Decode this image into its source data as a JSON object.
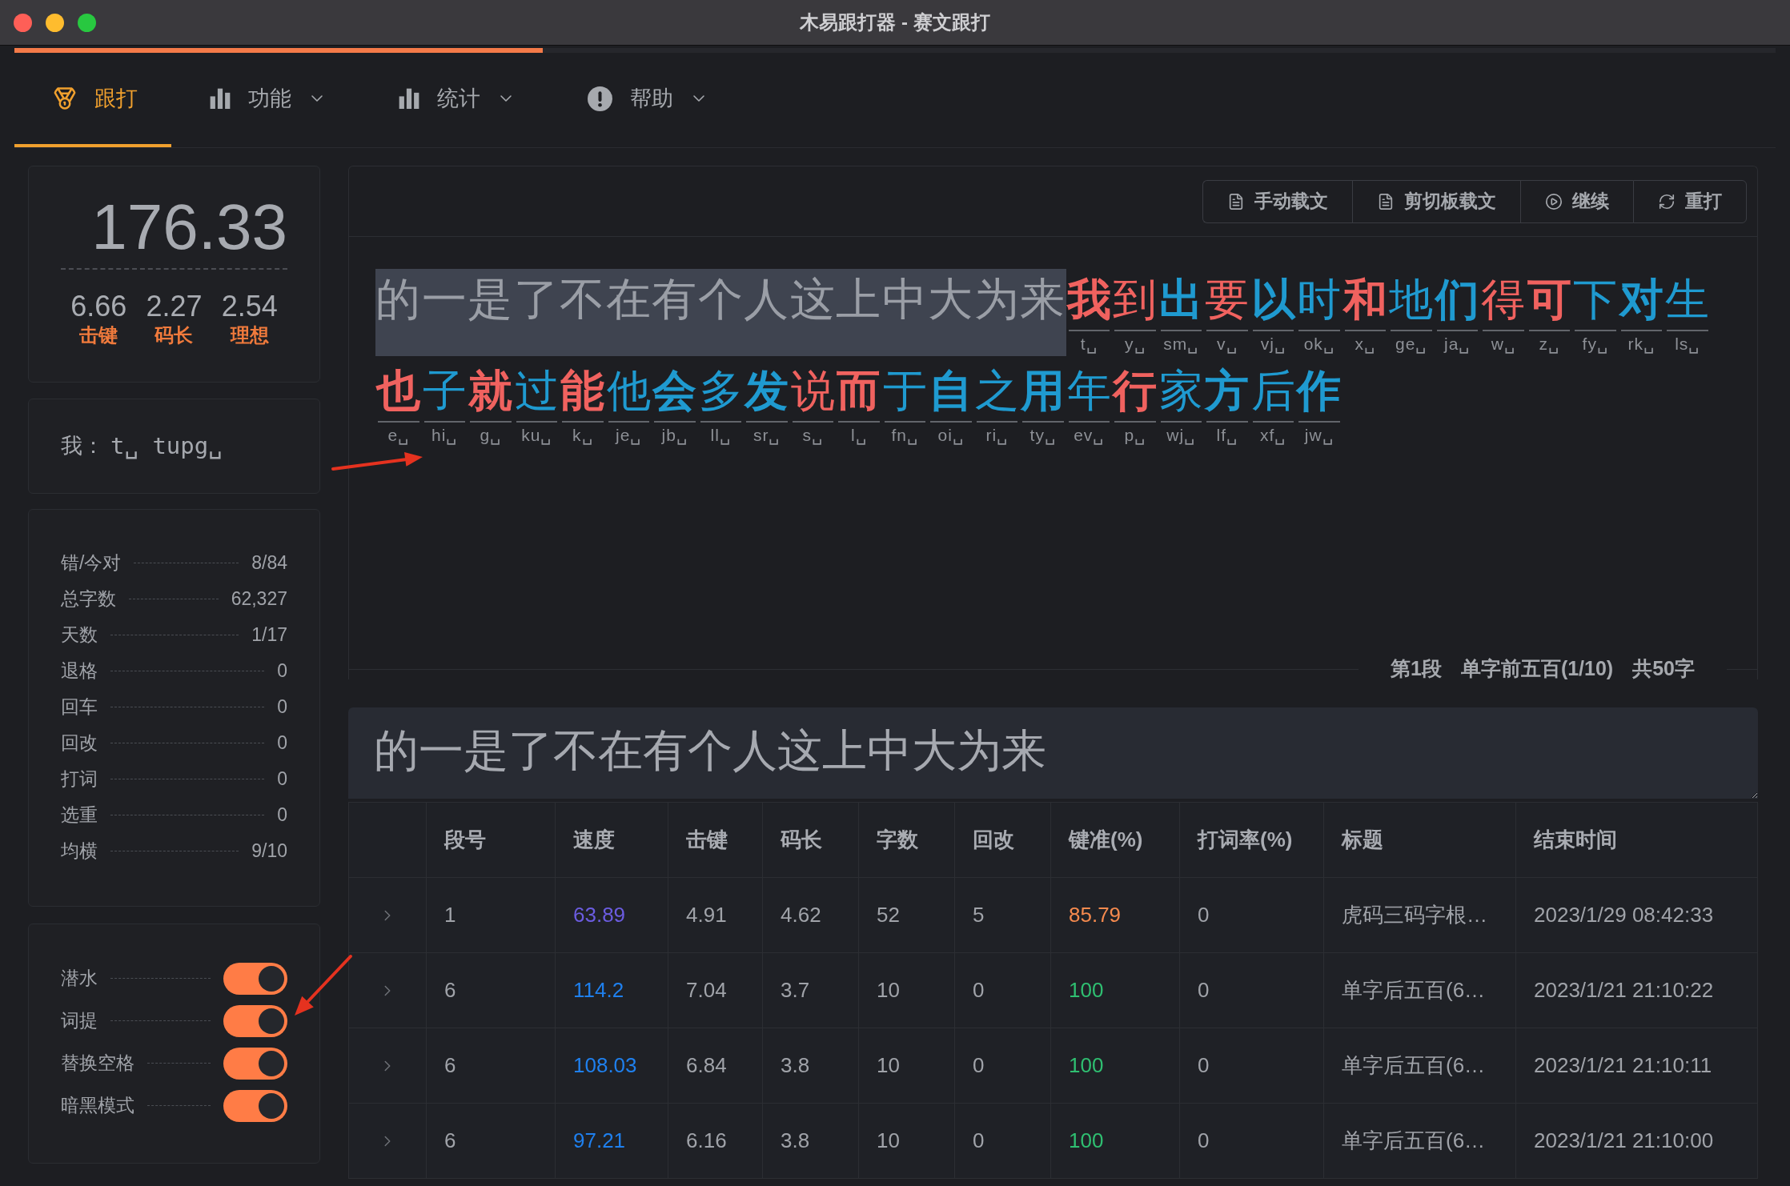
{
  "window": {
    "title": "木易跟打器 - 赛文跟打"
  },
  "progress": {
    "level": 0.3
  },
  "tabs": [
    {
      "label": "跟打",
      "selected": true,
      "has_menu": false
    },
    {
      "label": "功能",
      "selected": false,
      "has_menu": true
    },
    {
      "label": "统计",
      "selected": false,
      "has_menu": true
    },
    {
      "label": "帮助",
      "selected": false,
      "has_menu": true
    }
  ],
  "speed_panel": {
    "speed": "176.33",
    "stats": [
      {
        "value": "6.66",
        "label": "击键"
      },
      {
        "value": "2.27",
        "label": "码长"
      },
      {
        "value": "2.54",
        "label": "理想"
      }
    ]
  },
  "typing_hint": {
    "label": "我：",
    "codes": "t␣ tupg␣"
  },
  "stats": [
    {
      "label": "错/今对",
      "value": "8/84"
    },
    {
      "label": "总字数",
      "value": "62,327"
    },
    {
      "label": "天数",
      "value": "1/17"
    },
    {
      "label": "退格",
      "value": "0"
    },
    {
      "label": "回车",
      "value": "0"
    },
    {
      "label": "回改",
      "value": "0"
    },
    {
      "label": "打词",
      "value": "0"
    },
    {
      "label": "选重",
      "value": "0"
    },
    {
      "label": "均横",
      "value": "9/10"
    }
  ],
  "switches": [
    {
      "label": "潜水",
      "on": true
    },
    {
      "label": "词提",
      "on": true
    },
    {
      "label": "替换空格",
      "on": true
    },
    {
      "label": "暗黑模式",
      "on": true
    }
  ],
  "toolbar": {
    "buttons": [
      "手动载文",
      "剪切板载文",
      "继续",
      "重打"
    ]
  },
  "passage": {
    "lines": [
      {
        "typed": "的一是了不在有个人这上中大为来",
        "chars": [
          {
            "char": "我",
            "code": "t␣",
            "color": "#f0625f"
          },
          {
            "char": "到",
            "code": "y␣",
            "color": "#f0625f"
          },
          {
            "char": "出",
            "code": "sm␣",
            "color": "#1f9ad0"
          },
          {
            "char": "要",
            "code": "v␣",
            "color": "#f0625f"
          },
          {
            "char": "以",
            "code": "vj␣",
            "color": "#1f9ad0"
          },
          {
            "char": "时",
            "code": "ok␣",
            "color": "#1f9ad0"
          },
          {
            "char": "和",
            "code": "x␣",
            "color": "#f0625f"
          },
          {
            "char": "地",
            "code": "ge␣",
            "color": "#1f9ad0"
          },
          {
            "char": "们",
            "code": "ja␣",
            "color": "#1f9ad0"
          },
          {
            "char": "得",
            "code": "w␣",
            "color": "#f0625f"
          },
          {
            "char": "可",
            "code": "z␣",
            "color": "#f0625f"
          },
          {
            "char": "下",
            "code": "fy␣",
            "color": "#1f9ad0"
          },
          {
            "char": "对",
            "code": "rk␣",
            "color": "#1f9ad0"
          },
          {
            "char": "生",
            "code": "ls␣",
            "color": "#1f9ad0"
          }
        ]
      },
      {
        "chars": [
          {
            "char": "也",
            "code": "e␣",
            "color": "#f0625f"
          },
          {
            "char": "子",
            "code": "hi␣",
            "color": "#1f9ad0"
          },
          {
            "char": "就",
            "code": "g␣",
            "color": "#f0625f"
          },
          {
            "char": "过",
            "code": "ku␣",
            "color": "#1f9ad0"
          },
          {
            "char": "能",
            "code": "k␣",
            "color": "#f0625f"
          },
          {
            "char": "他",
            "code": "je␣",
            "color": "#1f9ad0"
          },
          {
            "char": "会",
            "code": "jb␣",
            "color": "#1f9ad0"
          },
          {
            "char": "多",
            "code": "ll␣",
            "color": "#1f9ad0"
          },
          {
            "char": "发",
            "code": "sr␣",
            "color": "#1f9ad0"
          },
          {
            "char": "说",
            "code": "s␣",
            "color": "#f0625f"
          },
          {
            "char": "而",
            "code": "l␣",
            "color": "#f0625f"
          },
          {
            "char": "于",
            "code": "fn␣",
            "color": "#1f9ad0"
          },
          {
            "char": "自",
            "code": "oi␣",
            "color": "#1f9ad0"
          },
          {
            "char": "之",
            "code": "ri␣",
            "color": "#1f9ad0"
          },
          {
            "char": "用",
            "code": "ty␣",
            "color": "#1f9ad0"
          },
          {
            "char": "年",
            "code": "ev␣",
            "color": "#1f9ad0"
          },
          {
            "char": "行",
            "code": "p␣",
            "color": "#f0625f"
          },
          {
            "char": "家",
            "code": "wj␣",
            "color": "#1f9ad0"
          },
          {
            "char": "方",
            "code": "lf␣",
            "color": "#1f9ad0"
          },
          {
            "char": "后",
            "code": "xf␣",
            "color": "#1f9ad0"
          },
          {
            "char": "作",
            "code": "jw␣",
            "color": "#1f9ad0"
          }
        ]
      }
    ]
  },
  "status": [
    "第1段",
    "单字前五百(1/10)",
    "共50字"
  ],
  "input": {
    "value": "的一是了不在有个人这上中大为来"
  },
  "table": {
    "columns": [
      "段号",
      "速度",
      "击键",
      "码长",
      "字数",
      "回改",
      "键准(%)",
      "打词率(%)",
      "标题",
      "结束时间"
    ],
    "rows": [
      {
        "expanded": false,
        "cells": [
          {
            "text": "1"
          },
          {
            "text": "63.89",
            "color": "#6b5ce0"
          },
          {
            "text": "4.91"
          },
          {
            "text": "4.62"
          },
          {
            "text": "52"
          },
          {
            "text": "5"
          },
          {
            "text": "85.79",
            "color": "#f58a4e"
          },
          {
            "text": "0"
          },
          {
            "text": "虎码三码字根…"
          },
          {
            "text": "2023/1/29 08:42:33"
          }
        ]
      },
      {
        "expanded": false,
        "cells": [
          {
            "text": "6"
          },
          {
            "text": "114.2",
            "color": "#1f80ee"
          },
          {
            "text": "7.04"
          },
          {
            "text": "3.7"
          },
          {
            "text": "10"
          },
          {
            "text": "0"
          },
          {
            "text": "100",
            "color": "#2fbf71"
          },
          {
            "text": "0"
          },
          {
            "text": "单字后五百(6…"
          },
          {
            "text": "2023/1/21 21:10:22"
          }
        ]
      },
      {
        "expanded": false,
        "cells": [
          {
            "text": "6"
          },
          {
            "text": "108.03",
            "color": "#1f80ee"
          },
          {
            "text": "6.84"
          },
          {
            "text": "3.8"
          },
          {
            "text": "10"
          },
          {
            "text": "0"
          },
          {
            "text": "100",
            "color": "#2fbf71"
          },
          {
            "text": "0"
          },
          {
            "text": "单字后五百(6…"
          },
          {
            "text": "2023/1/21 21:10:11"
          }
        ]
      },
      {
        "expanded": false,
        "cells": [
          {
            "text": "6"
          },
          {
            "text": "97.21",
            "color": "#1f80ee"
          },
          {
            "text": "6.16"
          },
          {
            "text": "3.8"
          },
          {
            "text": "10"
          },
          {
            "text": "0"
          },
          {
            "text": "100",
            "color": "#2fbf71"
          },
          {
            "text": "0"
          },
          {
            "text": "单字后五百(6…"
          },
          {
            "text": "2023/1/21 21:10:00"
          }
        ]
      }
    ]
  }
}
